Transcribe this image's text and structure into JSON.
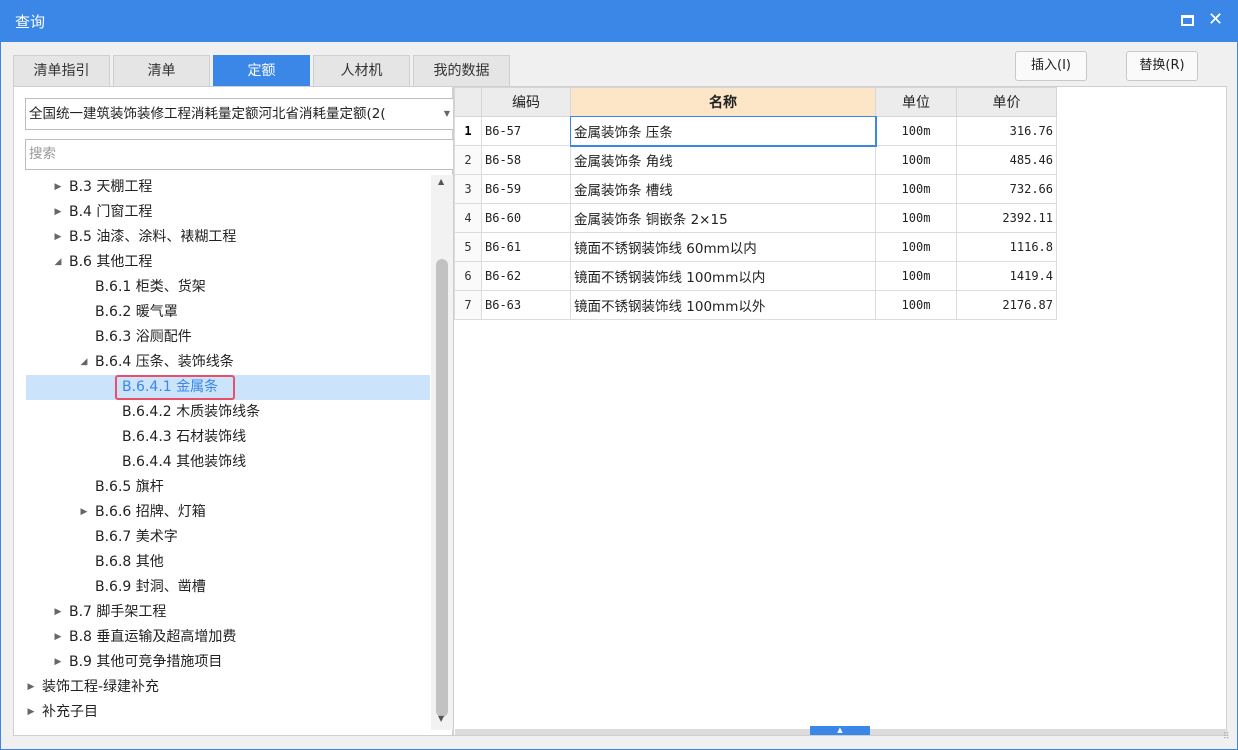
{
  "window": {
    "title": "查询",
    "maximize_icon": "maximize-icon",
    "close_glyph": "✕"
  },
  "tabs": [
    {
      "label": "清单指引",
      "active": false
    },
    {
      "label": "清单",
      "active": false
    },
    {
      "label": "定额",
      "active": true
    },
    {
      "label": "人材机",
      "active": false
    },
    {
      "label": "我的数据",
      "active": false
    }
  ],
  "buttons": {
    "insert": "插入(I)",
    "replace": "替换(R)"
  },
  "left": {
    "library_value": "全国统一建筑装饰装修工程消耗量定额河北省消耗量定额(2(",
    "search_placeholder": "搜索",
    "tree": [
      {
        "label": "B.3 天棚工程",
        "level": 1,
        "expander": "collapsed"
      },
      {
        "label": "B.4 门窗工程",
        "level": 1,
        "expander": "collapsed"
      },
      {
        "label": "B.5 油漆、涂料、裱糊工程",
        "level": 1,
        "expander": "collapsed"
      },
      {
        "label": "B.6 其他工程",
        "level": 1,
        "expander": "expanded"
      },
      {
        "label": "B.6.1 柜类、货架",
        "level": 2,
        "expander": "none"
      },
      {
        "label": "B.6.2 暖气罩",
        "level": 2,
        "expander": "none"
      },
      {
        "label": "B.6.3 浴厕配件",
        "level": 2,
        "expander": "none"
      },
      {
        "label": "B.6.4 压条、装饰线条",
        "level": 2,
        "expander": "expanded"
      },
      {
        "label": "B.6.4.1 金属条",
        "level": 3,
        "expander": "none",
        "selected": true
      },
      {
        "label": "B.6.4.2 木质装饰线条",
        "level": 3,
        "expander": "none"
      },
      {
        "label": "B.6.4.3 石材装饰线",
        "level": 3,
        "expander": "none"
      },
      {
        "label": "B.6.4.4 其他装饰线",
        "level": 3,
        "expander": "none"
      },
      {
        "label": "B.6.5 旗杆",
        "level": 2,
        "expander": "none"
      },
      {
        "label": "B.6.6 招牌、灯箱",
        "level": 2,
        "expander": "collapsed"
      },
      {
        "label": "B.6.7 美术字",
        "level": 2,
        "expander": "none"
      },
      {
        "label": "B.6.8 其他",
        "level": 2,
        "expander": "none"
      },
      {
        "label": "B.6.9 封洞、凿槽",
        "level": 2,
        "expander": "none"
      },
      {
        "label": "B.7 脚手架工程",
        "level": 1,
        "expander": "collapsed"
      },
      {
        "label": "B.8 垂直运输及超高增加费",
        "level": 1,
        "expander": "collapsed"
      },
      {
        "label": "B.9 其他可竞争措施项目",
        "level": 1,
        "expander": "collapsed"
      },
      {
        "label": "装饰工程-绿建补充",
        "level": 0,
        "expander": "collapsed"
      },
      {
        "label": "补充子目",
        "level": 0,
        "expander": "collapsed"
      }
    ]
  },
  "grid": {
    "headers": {
      "code": "编码",
      "name": "名称",
      "unit": "单位",
      "price": "单价"
    },
    "rows": [
      {
        "num": "1",
        "code": "B6-57",
        "name": "金属装饰条 压条",
        "unit": "100m",
        "price": "316.76",
        "current": true
      },
      {
        "num": "2",
        "code": "B6-58",
        "name": "金属装饰条 角线",
        "unit": "100m",
        "price": "485.46"
      },
      {
        "num": "3",
        "code": "B6-59",
        "name": "金属装饰条 槽线",
        "unit": "100m",
        "price": "732.66"
      },
      {
        "num": "4",
        "code": "B6-60",
        "name": "金属装饰条 铜嵌条 2×15",
        "unit": "100m",
        "price": "2392.11"
      },
      {
        "num": "5",
        "code": "B6-61",
        "name": "镜面不锈钢装饰线 60mm以内",
        "unit": "100m",
        "price": "1116.8"
      },
      {
        "num": "6",
        "code": "B6-62",
        "name": "镜面不锈钢装饰线 100mm以内",
        "unit": "100m",
        "price": "1419.4"
      },
      {
        "num": "7",
        "code": "B6-63",
        "name": "镜面不锈钢装饰线 100mm以外",
        "unit": "100m",
        "price": "2176.87"
      }
    ]
  },
  "glyphs": {
    "collapsed": "▶",
    "expanded": "◢",
    "dropdown": "▼",
    "scroll_up": "▲",
    "scroll_down": "▼",
    "grip": "▲",
    "resize": "⠿"
  },
  "colors": {
    "accent": "#3a87e8",
    "selection": "#cce4fb",
    "highlight_border": "#e8506a",
    "name_header": "#fde5c8"
  }
}
